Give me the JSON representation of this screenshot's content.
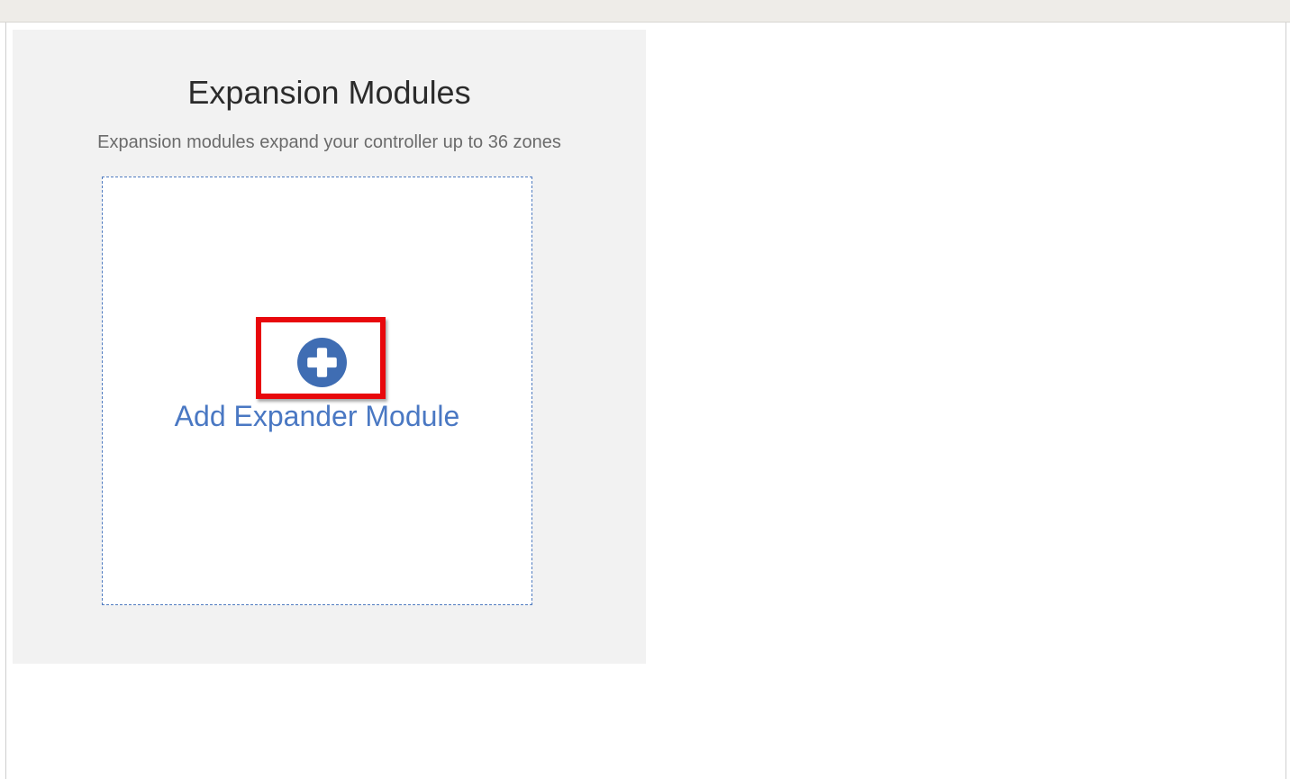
{
  "panel": {
    "title": "Expansion Modules",
    "subtitle": "Expansion modules expand your controller up to 36 zones"
  },
  "add_module": {
    "label": "Add Expander Module",
    "icon": "plus-circle-icon",
    "accent_color": "#3f6db3",
    "highlight_color": "#e8080c"
  }
}
